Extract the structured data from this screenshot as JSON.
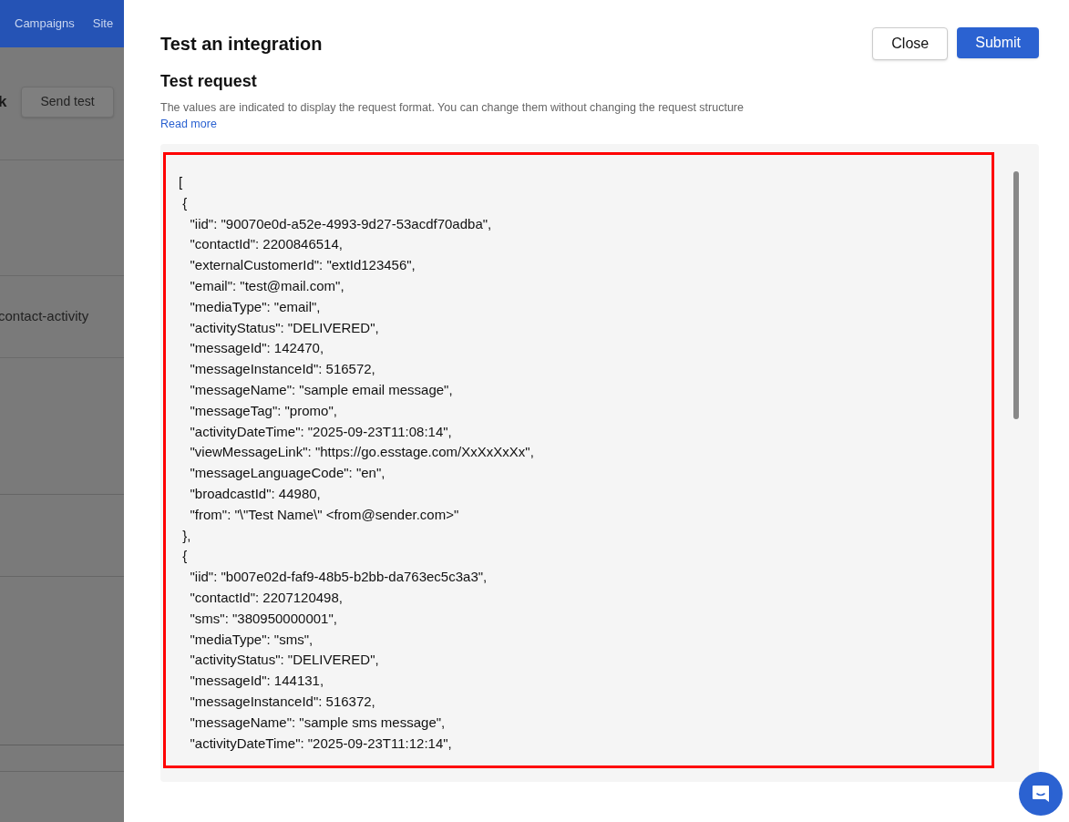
{
  "background_page": {
    "nav": [
      "Campaigns",
      "Site"
    ],
    "title_fragment": "k",
    "send_test_button": "Send test",
    "row_text": "contact-activity"
  },
  "dialog": {
    "title": "Test an integration",
    "buttons": [
      {
        "label": "Close",
        "kind": "secondary"
      },
      {
        "label": "Submit",
        "kind": "primary"
      }
    ],
    "section_title": "Test request",
    "description": "The values are indicated to display the request format. You can change them without changing the request structure",
    "link": "Read more",
    "code_lines": [
      "[",
      " {",
      "   \"iid\": \"90070e0d-a52e-4993-9d27-53acdf70adba\",",
      "   \"contactId\": 2200846514,",
      "   \"externalCustomerId\": \"extId123456\",",
      "   \"email\": \"test@mail.com\",",
      "   \"mediaType\": \"email\",",
      "   \"activityStatus\": \"DELIVERED\",",
      "   \"messageId\": 142470,",
      "   \"messageInstanceId\": 516572,",
      "   \"messageName\": \"sample email message\",",
      "   \"messageTag\": \"promo\",",
      "   \"activityDateTime\": \"2025-09-23T11:08:14\",",
      "   \"viewMessageLink\": \"https://go.esstage.com/XxXxXxXx\",",
      "   \"messageLanguageCode\": \"en\",",
      "   \"broadcastId\": 44980,",
      "   \"from\": \"\\\"Test Name\\\" <from@sender.com>\"",
      " },",
      " {",
      "   \"iid\": \"b007e02d-faf9-48b5-b2bb-da763ec5c3a3\",",
      "   \"contactId\": 2207120498,",
      "   \"sms\": \"380950000001\",",
      "   \"mediaType\": \"sms\",",
      "   \"activityStatus\": \"DELIVERED\",",
      "   \"messageId\": 144131,",
      "   \"messageInstanceId\": 516372,",
      "   \"messageName\": \"sample sms message\",",
      "   \"activityDateTime\": \"2025-09-23T11:12:14\","
    ]
  }
}
